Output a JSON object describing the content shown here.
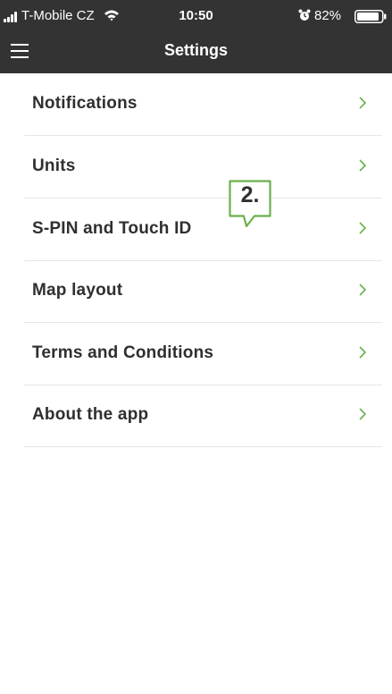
{
  "status_bar": {
    "carrier": "T-Mobile CZ",
    "time": "10:50",
    "battery_percent": "82%",
    "icons": [
      "signal-icon",
      "wifi-icon",
      "alarm-icon",
      "battery-icon"
    ]
  },
  "nav": {
    "title": "Settings",
    "menu_icon": "hamburger-menu-icon"
  },
  "settings": {
    "items": [
      {
        "label": "Notifications"
      },
      {
        "label": "Units"
      },
      {
        "label": "S-PIN and Touch ID"
      },
      {
        "label": "Map layout"
      },
      {
        "label": "Terms and Conditions"
      },
      {
        "label": "About the app"
      }
    ]
  },
  "annotation": {
    "label": "2."
  },
  "colors": {
    "header_background": "#333333",
    "accent_green": "#6ab04c",
    "text": "#2f2f2f",
    "divider": "#e6e6e6"
  }
}
